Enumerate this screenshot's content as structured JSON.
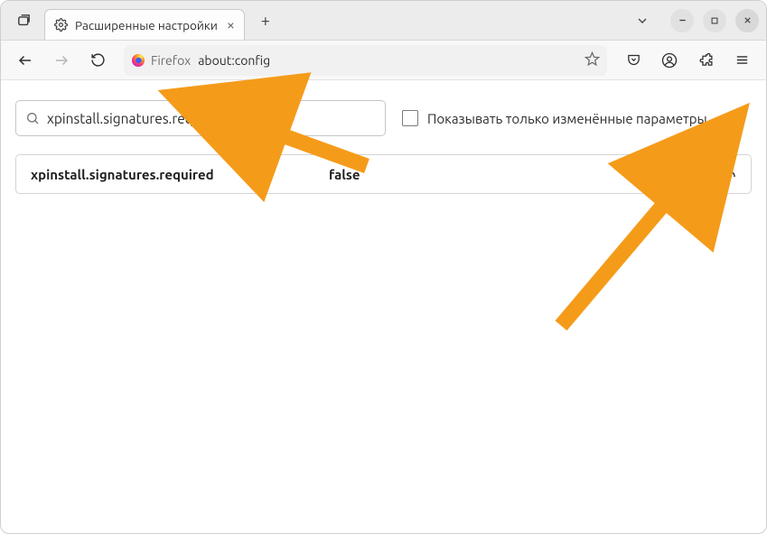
{
  "titlebar": {
    "tab_title": "Расширенные настройки",
    "new_tab_label": "+"
  },
  "toolbar": {
    "identity_label": "Firefox",
    "address": "about:config"
  },
  "search": {
    "value": "xpinstall.signatures.required",
    "show_modified_only_label": "Показывать только изменённые параметры",
    "show_modified_only_checked": false
  },
  "result": {
    "pref_name": "xpinstall.signatures.required",
    "pref_value": "false"
  },
  "colors": {
    "annotation": "#f59b1a"
  }
}
